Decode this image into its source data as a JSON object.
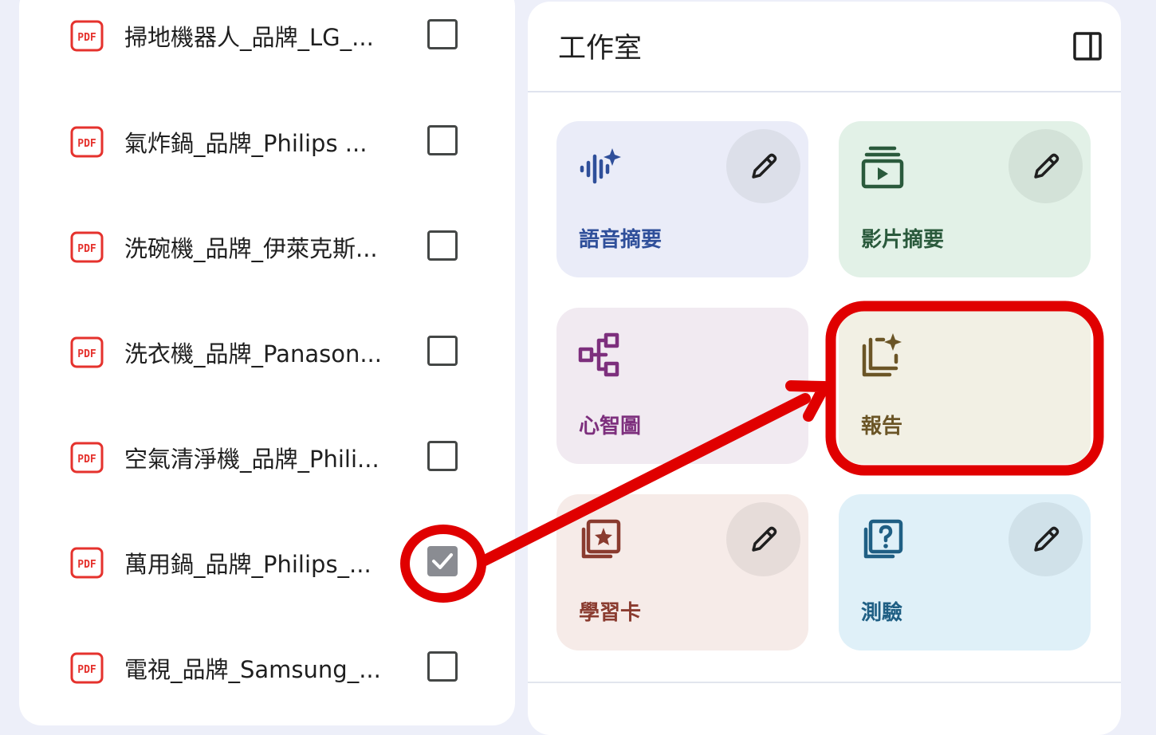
{
  "sources": {
    "items": [
      {
        "title": "掃地機器人_品牌_LG_...",
        "checked": false
      },
      {
        "title": "氣炸鍋_品牌_Philips ...",
        "checked": false
      },
      {
        "title": "洗碗機_品牌_伊萊克斯...",
        "checked": false
      },
      {
        "title": "洗衣機_品牌_Panason...",
        "checked": false
      },
      {
        "title": "空氣清淨機_品牌_Phili...",
        "checked": false
      },
      {
        "title": "萬用鍋_品牌_Philips_...",
        "checked": true
      },
      {
        "title": "電視_品牌_Samsung_...",
        "checked": false
      }
    ],
    "icon_label": "PDF"
  },
  "studio": {
    "title": "工作室",
    "tiles": [
      {
        "label": "語音摘要",
        "icon": "audio-overview-icon",
        "bg": "#eaecf8",
        "fg": "#2f4f9a",
        "edit_bg": "#dcdfe9",
        "has_edit": true
      },
      {
        "label": "影片摘要",
        "icon": "video-overview-icon",
        "bg": "#e2f1e7",
        "fg": "#2a5a3c",
        "edit_bg": "#d3e2d8",
        "has_edit": true
      },
      {
        "label": "心智圖",
        "icon": "mind-map-icon",
        "bg": "#f1eaf1",
        "fg": "#7d2f7d",
        "edit_bg": "#e2dbe2",
        "has_edit": false
      },
      {
        "label": "報告",
        "icon": "report-icon",
        "bg": "#f2f0e4",
        "fg": "#6b5526",
        "edit_bg": "#e3e1d5",
        "has_edit": false
      },
      {
        "label": "學習卡",
        "icon": "flashcards-icon",
        "bg": "#f6ebe8",
        "fg": "#8a3b2f",
        "edit_bg": "#e6dcd9",
        "has_edit": true
      },
      {
        "label": "測驗",
        "icon": "quiz-icon",
        "bg": "#dff0f8",
        "fg": "#1f5f84",
        "edit_bg": "#d0e1e9",
        "has_edit": true
      }
    ]
  },
  "colors": {
    "pdf_red": "#e5322d",
    "annotation_red": "#e00000"
  }
}
